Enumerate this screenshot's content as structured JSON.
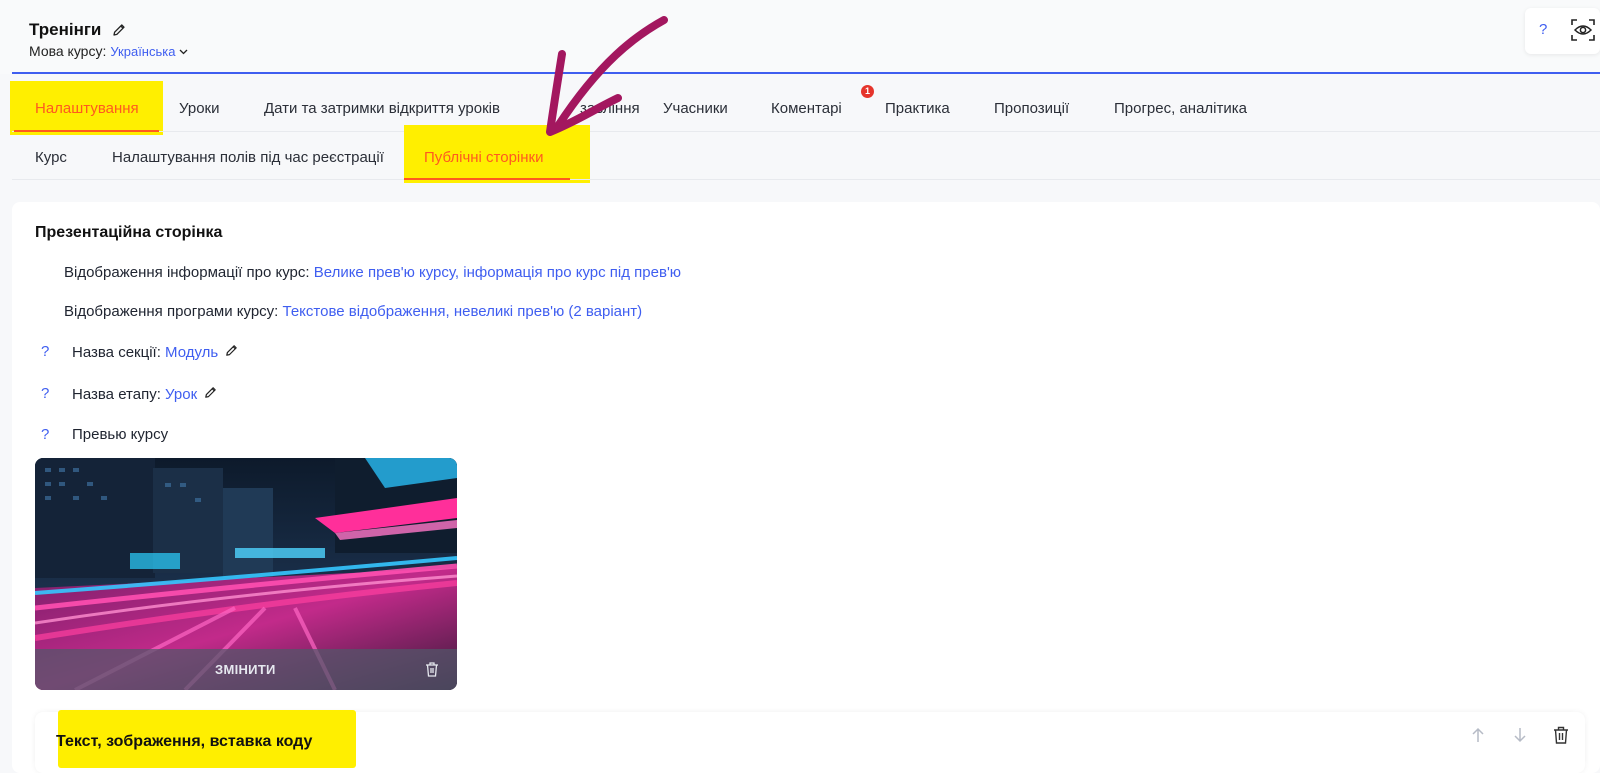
{
  "header": {
    "title": "Тренінги",
    "lang_label": "Мова курсу:",
    "lang_value": "Українська",
    "help": "?"
  },
  "tabs_main": [
    {
      "label": "Налаштування",
      "active": true
    },
    {
      "label": "Уроки"
    },
    {
      "label": "Дати та затримки відкриття уроків"
    },
    {
      "label": "Оплата, завдання (partially hidden: ...авління)"
    },
    {
      "label": "Учасники"
    },
    {
      "label": "Коментарі",
      "badge": "1"
    },
    {
      "label": "Практика"
    },
    {
      "label": "Пропозиції"
    },
    {
      "label": "Прогрес, аналітика"
    }
  ],
  "tab4_visible_text": "завління",
  "tabs_sub": [
    {
      "label": "Курс"
    },
    {
      "label": "Налаштування полів під час реєстрації"
    },
    {
      "label": "Публічні сторінки",
      "active": true
    }
  ],
  "section": {
    "title": "Презентаційна сторінка",
    "info_label": "Відображення інформації про курс:",
    "info_value": "Велике прев'ю курсу, інформація про курс під прев'ю",
    "program_label": "Відображення програми курсу:",
    "program_value": "Текстове відображення, невеликі прев'ю (2 варіант)",
    "section_name_label": "Назва секції:",
    "section_name_value": "Модуль",
    "stage_name_label": "Назва етапу:",
    "stage_name_value": "Урок",
    "preview_label": "Превью курсу",
    "qmark": "?",
    "change_button": "ЗМІНИТИ"
  },
  "block": {
    "title": "Текст, зображення, вставка коду"
  },
  "colors": {
    "accent": "#3f5ef0",
    "active_tab": "#ff5a1f",
    "highlight": "#ffef00",
    "annotation_arrow": "#a3175f",
    "badge": "#e5342b"
  }
}
